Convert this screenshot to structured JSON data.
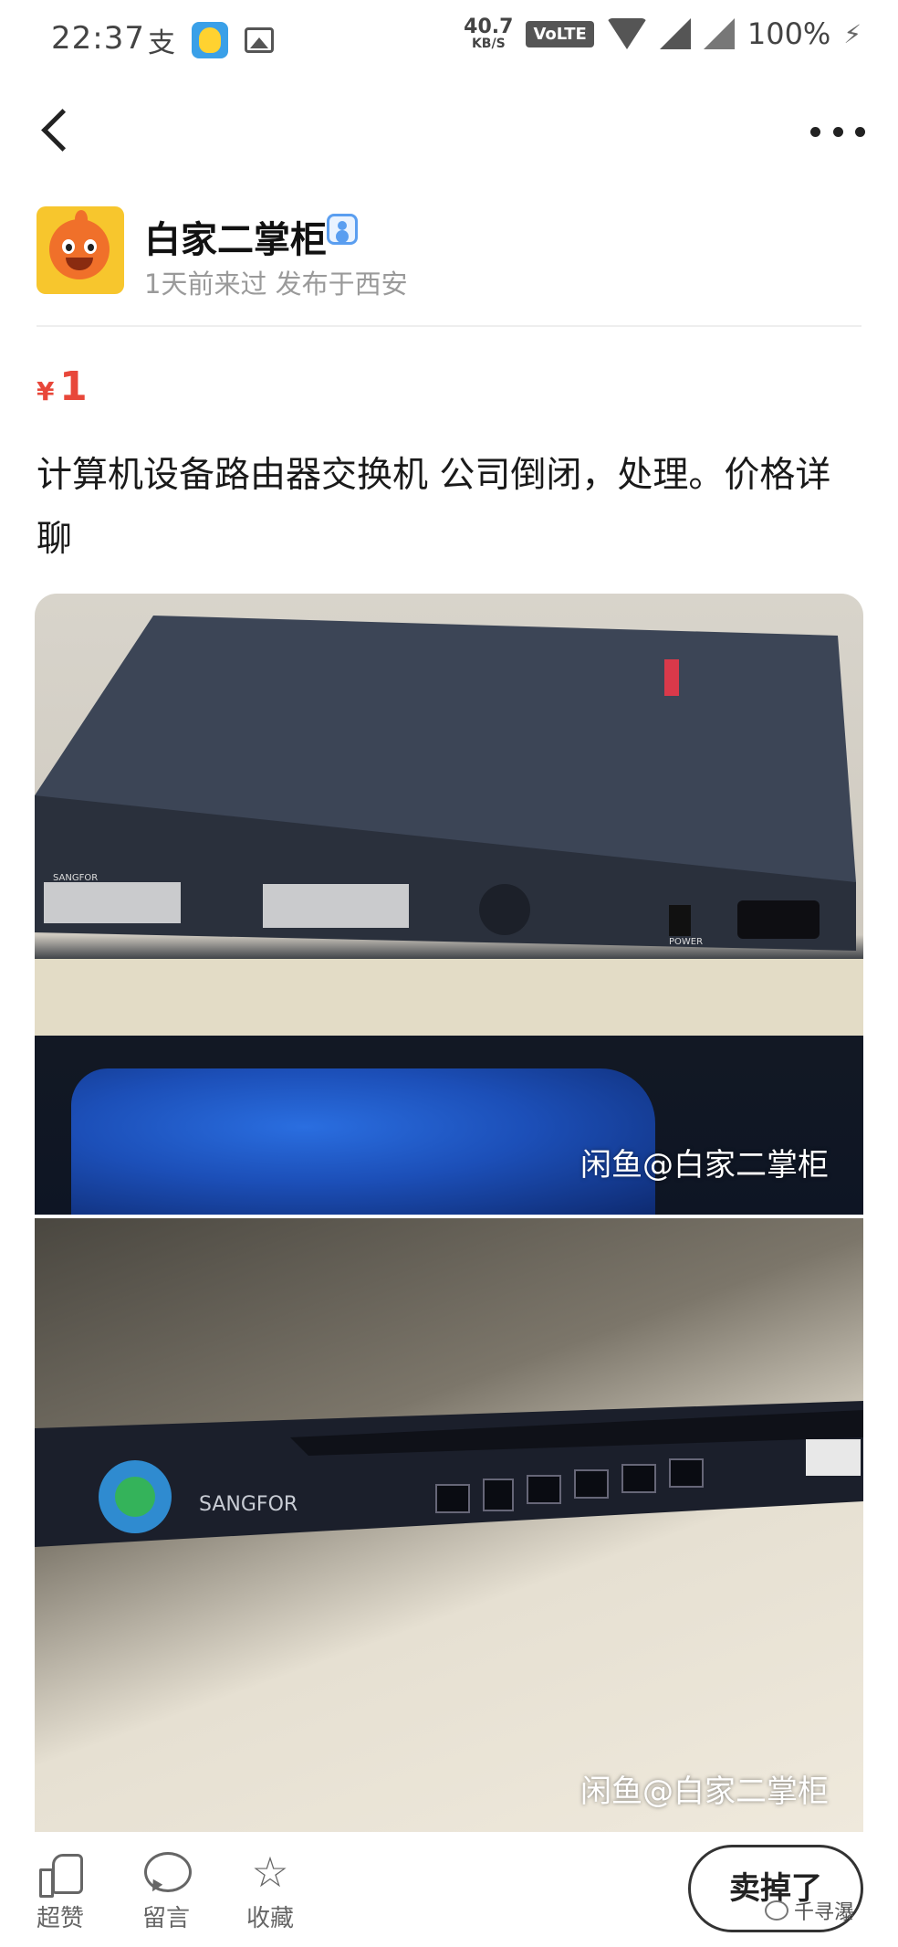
{
  "status_bar": {
    "time": "22:37",
    "icon_text": "支",
    "net_speed": "40.7",
    "net_unit": "KB/S",
    "volte": "VoLTE",
    "battery": "100%"
  },
  "nav": {
    "back_icon": "chevron-left-icon",
    "more_icon": "more-dots-icon"
  },
  "seller": {
    "name": "白家二掌柜",
    "meta": "1天前来过 发布于西安"
  },
  "listing": {
    "price_currency": "¥",
    "price": "1",
    "title": "计算机设备路由器交换机 公司倒闭，处理。价格详聊"
  },
  "photos": [
    {
      "watermark": "闲鱼@白家二掌柜",
      "brand": "SANGFOR",
      "power_label": "POWER"
    },
    {
      "watermark": "闲鱼@白家二掌柜",
      "brand": "SANGFOR"
    }
  ],
  "bottom_bar": {
    "like_label": "超赞",
    "comment_label": "留言",
    "favorite_label": "收藏",
    "sold_label": "卖掉了",
    "brand_watermark": "千寻瀑"
  },
  "colors": {
    "price": "#e8473a",
    "avatar_bg": "#f7c62d",
    "verify": "#5a9ef0"
  }
}
